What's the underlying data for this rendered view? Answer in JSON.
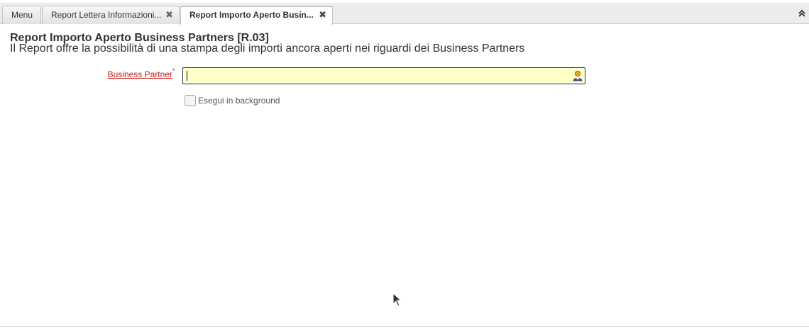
{
  "tabs": {
    "menu": "Menu",
    "tab1": "Report Lettera Informazioni...",
    "tab2": "Report Importo Aperto Busin...",
    "close_glyph": "✖"
  },
  "collapse_glyph": "⌃",
  "process": {
    "title": "Report Importo Aperto Business Partners [R.03]",
    "description": "Il Report offre la possibilità di una stampa degli importi ancora aperti nei riguardi dei Business Partners"
  },
  "fields": {
    "business_partner": {
      "label": "Business Partner",
      "mandatory_mark": "*",
      "value": ""
    },
    "run_in_background": {
      "label": "Esegui in background",
      "checked": false
    }
  },
  "colors": {
    "mandatory_label": "#c41a1a",
    "input_background": "#ffffc8",
    "input_border": "#1a2f6e"
  },
  "icons": {
    "business_partner_lookup": "person-icon",
    "tab_close": "close-icon",
    "collapse": "chevron-up-icon"
  }
}
